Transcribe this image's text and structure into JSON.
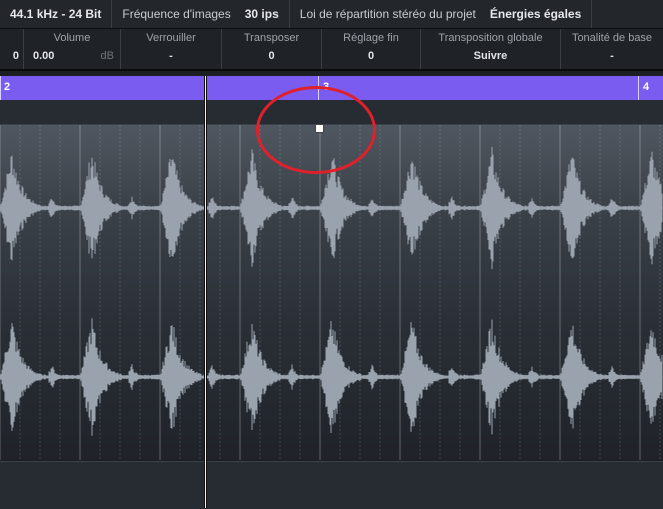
{
  "status_bar": {
    "sample_rate": "44.1 kHz - 24 Bit",
    "frame_rate_label": "Fréquence d'images",
    "frame_rate_value": "30 ips",
    "pan_law_label": "Loi de répartition stéréo du projet",
    "pan_law_value": "Énergies égales"
  },
  "info_line": {
    "prev_value": "0",
    "volume": {
      "label": "Volume",
      "value": "0.00",
      "unit": "dB"
    },
    "lock": {
      "label": "Verrouiller",
      "value": "-"
    },
    "transpose": {
      "label": "Transposer",
      "value": "0"
    },
    "fine_tune": {
      "label": "Réglage fin",
      "value": "0"
    },
    "global_transpose": {
      "label": "Transposition globale",
      "value": "Suivre"
    },
    "root_key": {
      "label": "Tonalité de base",
      "value": "-"
    }
  },
  "ruler": {
    "bars": [
      "2",
      "3",
      "4"
    ]
  },
  "colors": {
    "ruler": "#7a5cf0",
    "waveform": "#9aa3ad",
    "annotation": "#e0202a"
  },
  "icons": {
    "event_handle": "square-handle-icon"
  }
}
